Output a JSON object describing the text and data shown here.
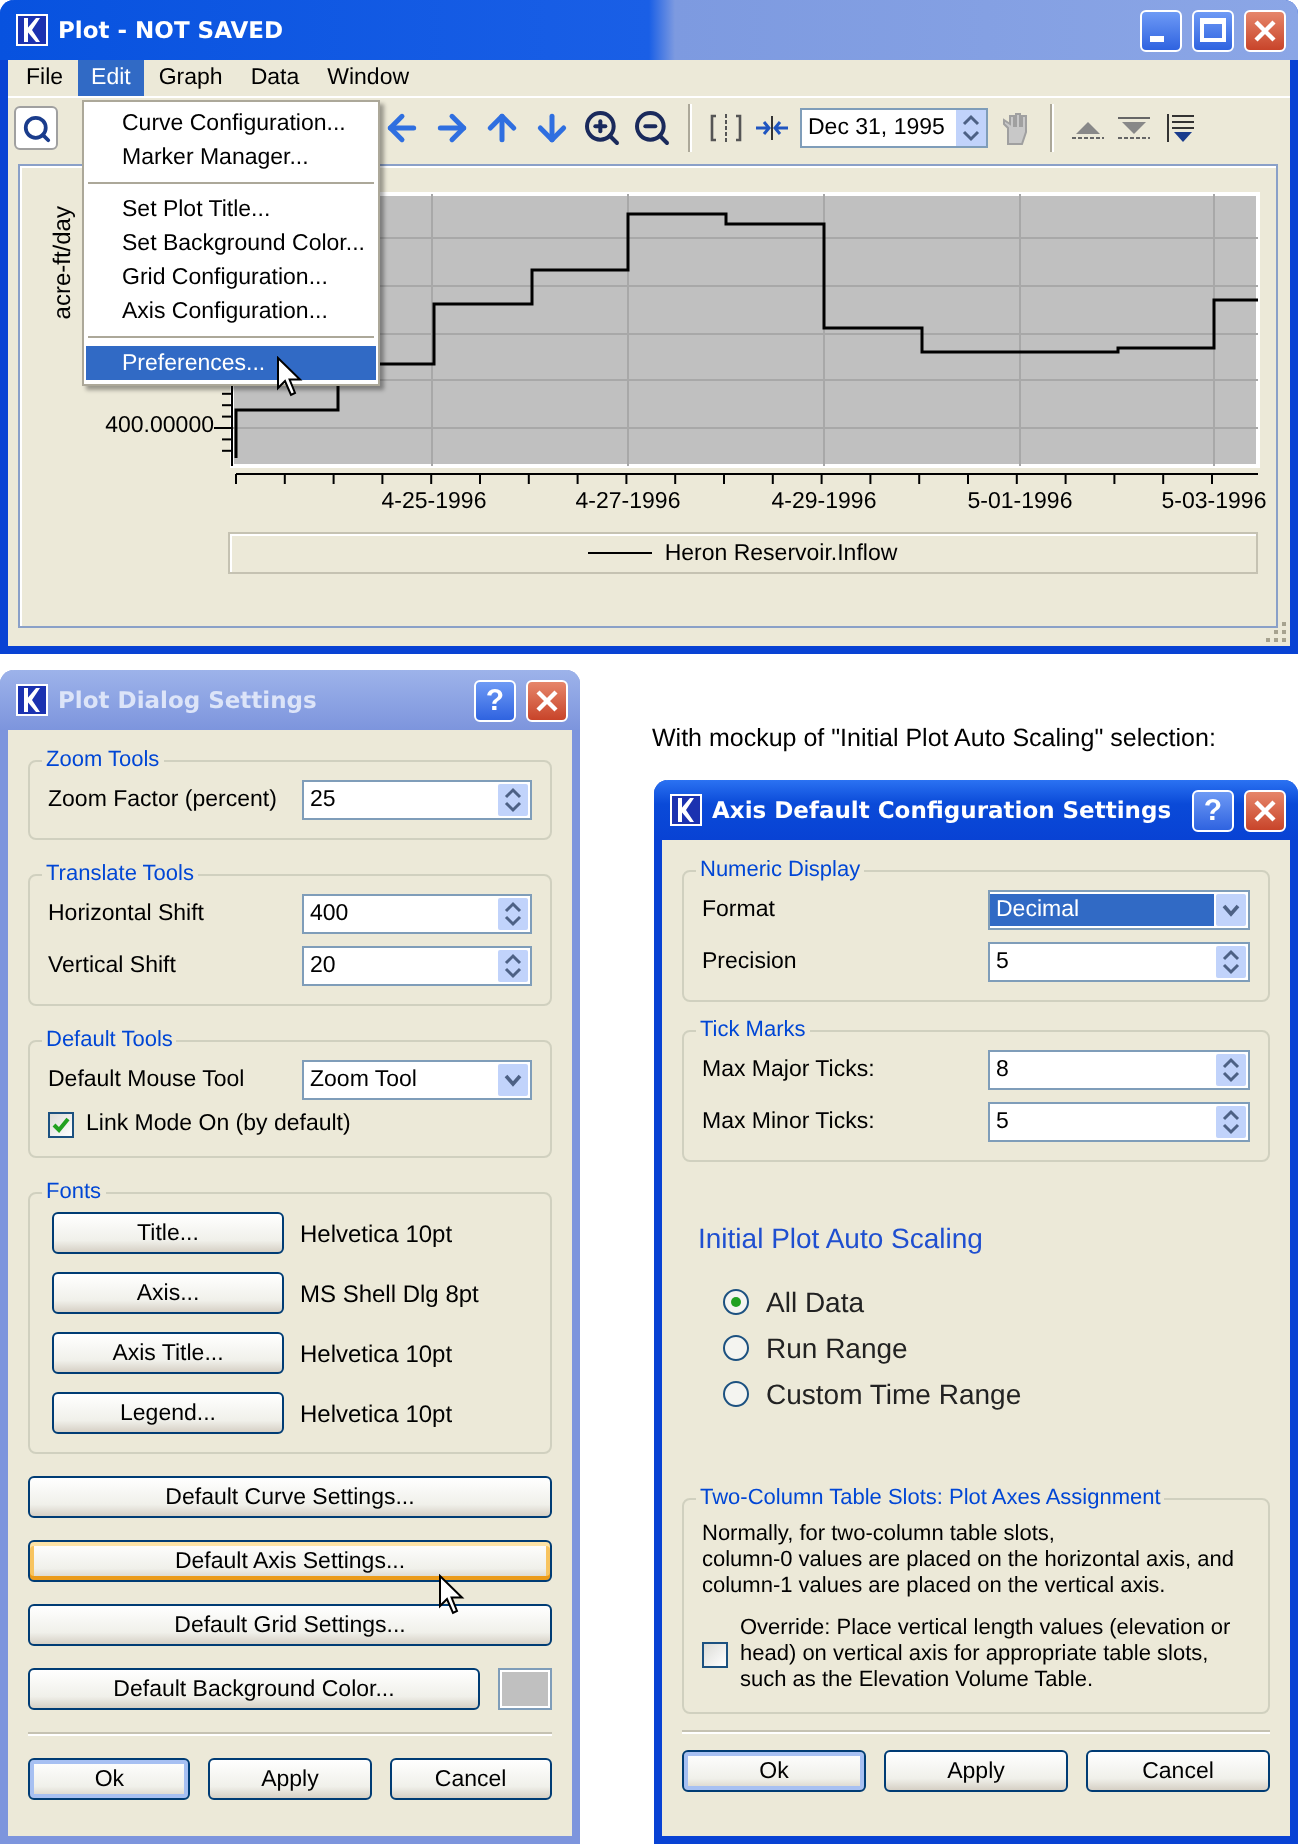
{
  "plot_window": {
    "title": "Plot - NOT SAVED",
    "active": true,
    "menus": [
      {
        "label": "File",
        "selected": false
      },
      {
        "label": "Edit",
        "selected": true
      },
      {
        "label": "Graph",
        "selected": false
      },
      {
        "label": "Data",
        "selected": false
      },
      {
        "label": "Window",
        "selected": false
      }
    ],
    "date_field": "Dec 31, 1995",
    "chart": {
      "y_label": "acre-ft/day",
      "y_tick": "400.00000",
      "x_ticks": [
        "4-25-1996",
        "4-27-1996",
        "4-29-1996",
        "5-01-1996",
        "5-03-1996"
      ],
      "legend": "Heron Reservoir.Inflow"
    },
    "open_menu": {
      "groups": [
        [
          {
            "label": "Curve Configuration...",
            "selected": false
          },
          {
            "label": "Marker Manager...",
            "selected": false
          }
        ],
        [
          {
            "label": "Set Plot Title...",
            "selected": false
          },
          {
            "label": "Set Background Color...",
            "selected": false
          },
          {
            "label": "Grid Configuration...",
            "selected": false
          },
          {
            "label": "Axis Configuration...",
            "selected": false
          }
        ],
        [
          {
            "label": "Preferences...",
            "selected": true
          }
        ]
      ]
    }
  },
  "plot_dialog": {
    "title": "Plot Dialog Settings",
    "active": false,
    "help": "?",
    "groups": [
      {
        "title": "Zoom Tools",
        "rows": [
          {
            "kind": "spinner",
            "label": "Zoom Factor (percent)",
            "value": "25"
          }
        ]
      },
      {
        "title": "Translate Tools",
        "rows": [
          {
            "kind": "spinner",
            "label": "Horizontal Shift",
            "value": "400"
          },
          {
            "kind": "spinner",
            "label": "Vertical Shift",
            "value": "20"
          }
        ]
      },
      {
        "title": "Default Tools",
        "rows": [
          {
            "kind": "dropdown",
            "label": "Default Mouse Tool",
            "value": "Zoom Tool",
            "focused": false
          },
          {
            "kind": "checkbox",
            "label": "Link Mode On (by default)",
            "checked": true
          }
        ]
      },
      {
        "title": "Fonts",
        "rows": [
          {
            "kind": "font",
            "label": "Title...",
            "value": "Helvetica 10pt"
          },
          {
            "kind": "font",
            "label": "Axis...",
            "value": "MS Shell Dlg 8pt"
          },
          {
            "kind": "font",
            "label": "Axis Title...",
            "value": "Helvetica 10pt"
          },
          {
            "kind": "font",
            "label": "Legend...",
            "value": "Helvetica 10pt"
          }
        ]
      }
    ],
    "buttons": [
      {
        "label": "Default Curve Settings...",
        "focused": false
      },
      {
        "label": "Default Axis Settings...",
        "focused": true
      },
      {
        "label": "Default Grid Settings...",
        "focused": false
      },
      {
        "label": "Default Background Color...",
        "focused": false,
        "color": "#c0c0c0"
      }
    ],
    "footer": [
      {
        "label": "Ok",
        "default": true
      },
      {
        "label": "Apply",
        "default": false
      },
      {
        "label": "Cancel",
        "default": false
      }
    ]
  },
  "caption": "With mockup of \"Initial Plot Auto Scaling\" selection:",
  "axis_dialog": {
    "title": "Axis Default Configuration Settings",
    "active": true,
    "help": "?",
    "groups": [
      {
        "title": "Numeric Display",
        "rows": [
          {
            "kind": "dropdown",
            "label": "Format",
            "value": "Decimal",
            "focused": true
          },
          {
            "kind": "spinner",
            "label": "Precision",
            "value": "5"
          }
        ]
      },
      {
        "title": "Tick Marks",
        "rows": [
          {
            "kind": "spinner",
            "label": "Max Major Ticks:",
            "value": "8"
          },
          {
            "kind": "spinner",
            "label": "Max Minor Ticks:",
            "value": "5"
          }
        ]
      }
    ],
    "scaling": {
      "title": "Initial Plot Auto Scaling",
      "options": [
        {
          "label": "All Data",
          "selected": true
        },
        {
          "label": "Run Range",
          "selected": false
        },
        {
          "label": "Custom Time Range",
          "selected": false
        }
      ]
    },
    "table_slots": {
      "title": "Two-Column Table Slots: Plot Axes Assignment",
      "text": "Normally, for two-column table slots,\ncolumn-0 values are placed on the horizontal axis, and\ncolumn-1 values are placed on the vertical axis.",
      "override": {
        "label": "Override: Place vertical length values (elevation or head) on vertical axis for appropriate table slots, such as the Elevation Volume Table.",
        "checked": false
      }
    },
    "footer": [
      {
        "label": "Ok",
        "default": true
      },
      {
        "label": "Apply",
        "default": false
      },
      {
        "label": "Cancel",
        "default": false
      }
    ]
  }
}
